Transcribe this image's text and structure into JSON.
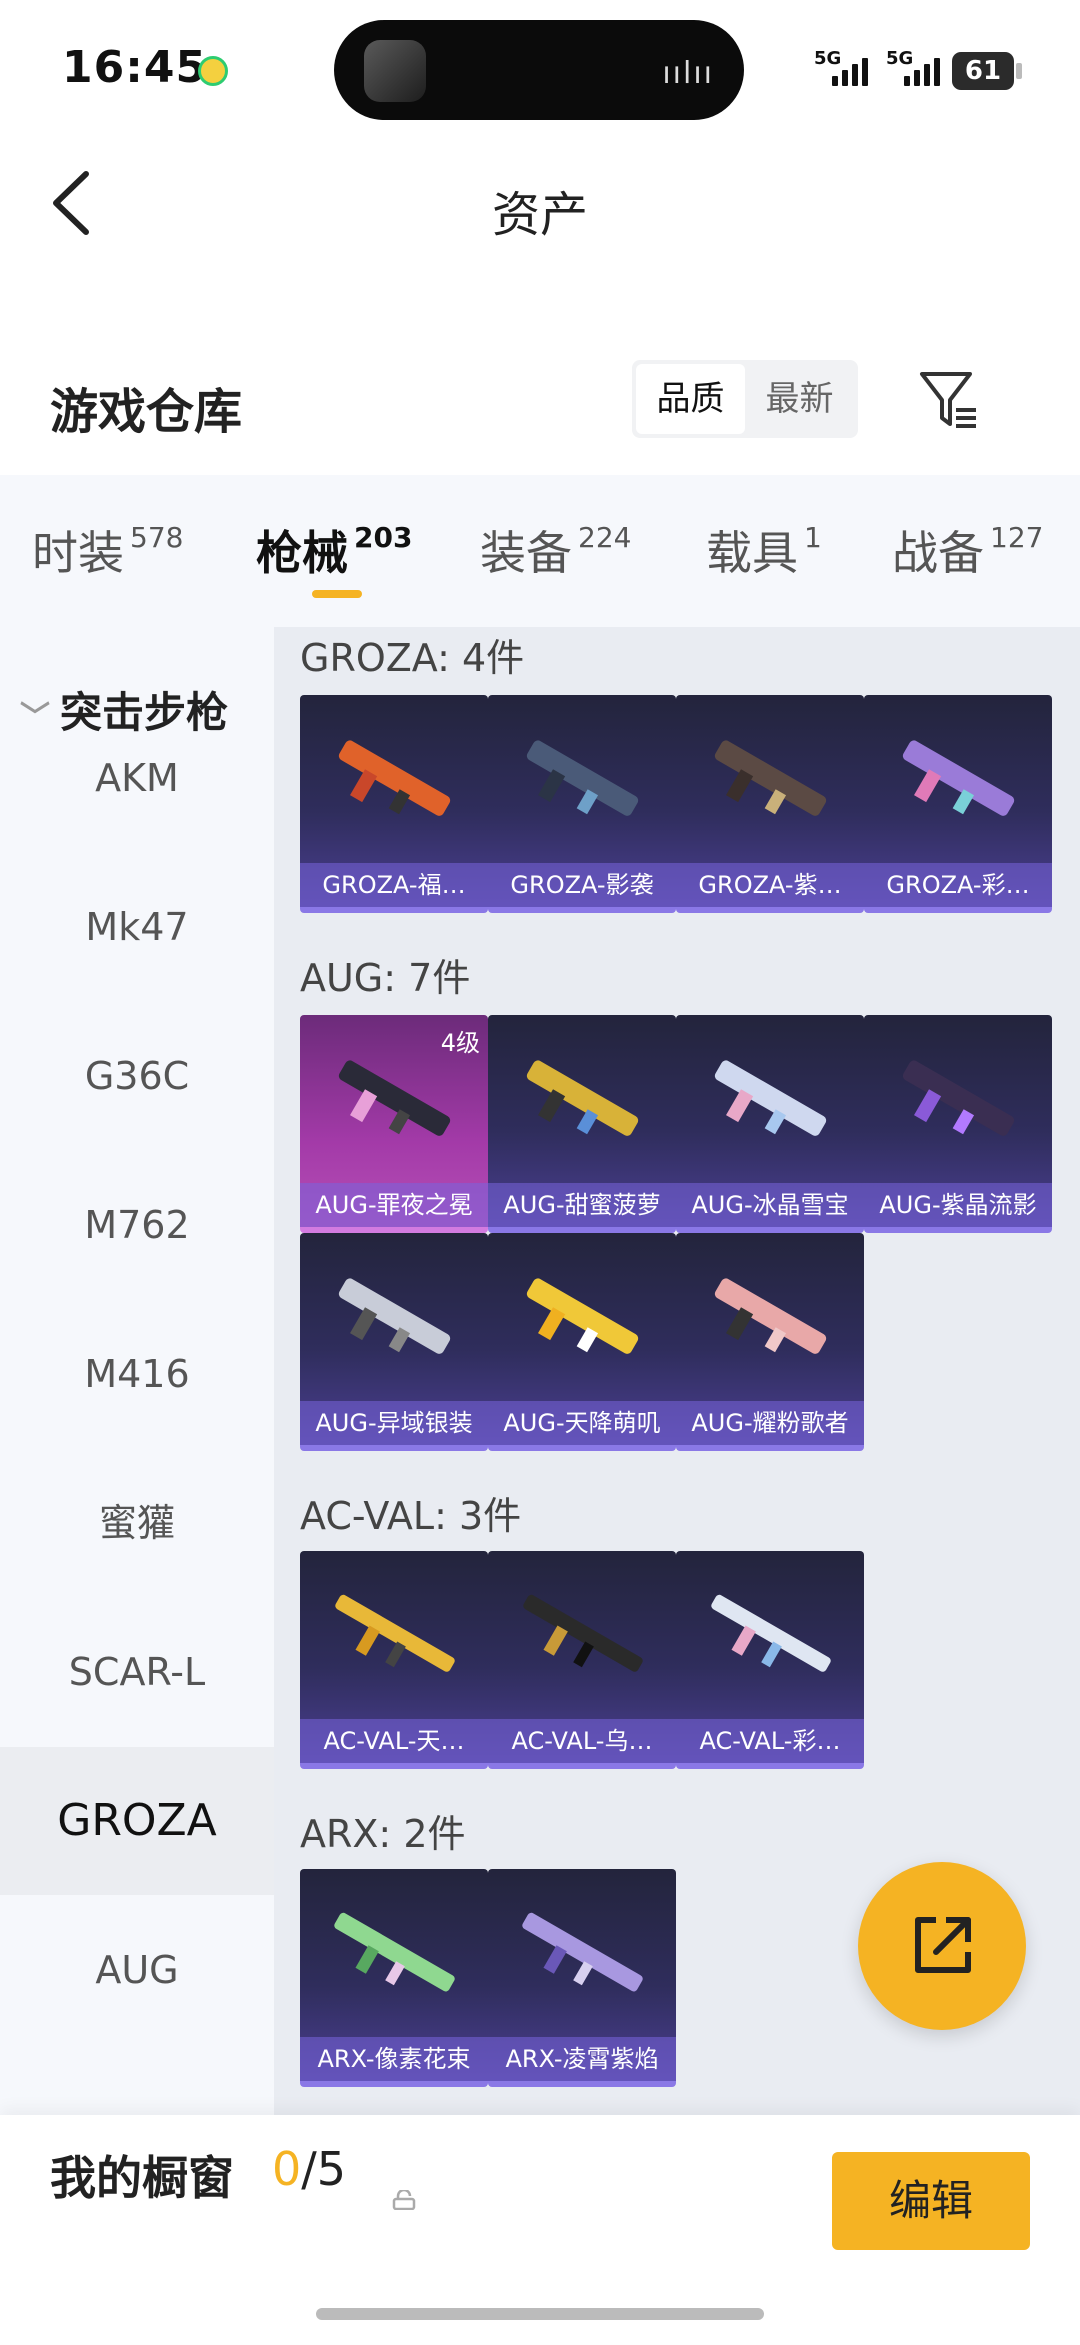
{
  "status_bar": {
    "time": "16:45",
    "net1": "5G",
    "net2": "5G",
    "battery": "61"
  },
  "nav": {
    "title": "资产"
  },
  "warehouse": {
    "title": "游戏仓库",
    "sort_options": [
      "品质",
      "最新"
    ]
  },
  "tabs": [
    {
      "label": "时装",
      "count": "578"
    },
    {
      "label": "枪械",
      "count": "203"
    },
    {
      "label": "装备",
      "count": "224"
    },
    {
      "label": "载具",
      "count": "1"
    },
    {
      "label": "战备",
      "count": "127"
    }
  ],
  "sidebar": {
    "category": "突击步枪",
    "items": [
      "AKM",
      "Mk47",
      "G36C",
      "M762",
      "M416",
      "蜜獾",
      "SCAR-L",
      "GROZA",
      "AUG"
    ]
  },
  "groups": {
    "groza": {
      "title": "GROZA: 4件",
      "items": [
        "GROZA-福…",
        "GROZA-影袭",
        "GROZA-紫…",
        "GROZA-彩…"
      ]
    },
    "aug": {
      "title": "AUG: 7件",
      "level_badge": "4级",
      "items": [
        "AUG-罪夜之冕",
        "AUG-甜蜜菠萝",
        "AUG-冰晶雪宝",
        "AUG-紫晶流影",
        "AUG-异域银装",
        "AUG-天降萌叽",
        "AUG-耀粉歌者"
      ]
    },
    "acval": {
      "title": "AC-VAL: 3件",
      "items": [
        "AC-VAL-天…",
        "AC-VAL-乌…",
        "AC-VAL-彩…"
      ]
    },
    "arx": {
      "title": "ARX: 2件",
      "items": [
        "ARX-像素花束",
        "ARX-凌霄紫焰"
      ]
    }
  },
  "bottom_bar": {
    "showcase_label": "我的橱窗",
    "count_current": "0",
    "count_total": "/5",
    "edit_label": "编辑"
  },
  "colors": {
    "accent": "#f5b323",
    "card_dark": "#2f2d5c",
    "card_highlight": "#a33aa8"
  }
}
